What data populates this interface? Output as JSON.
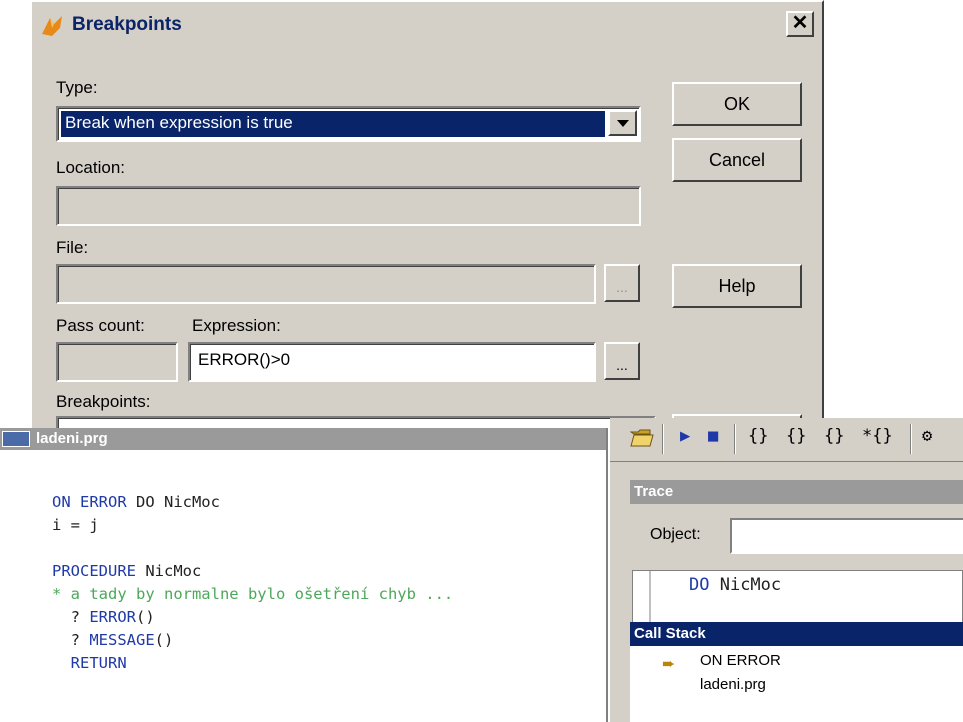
{
  "dialog": {
    "title": "Breakpoints",
    "close_label": "✕",
    "type_label": "Type:",
    "type_value": "Break when expression is true",
    "location_label": "Location:",
    "location_value": "",
    "file_label": "File:",
    "file_value": "",
    "pass_count_label": "Pass count:",
    "pass_count_value": "",
    "expression_label": "Expression:",
    "expression_value": "ERROR()>0",
    "breakpoints_label": "Breakpoints:",
    "browse_label": "...",
    "ok_label": "OK",
    "cancel_label": "Cancel",
    "help_label": "Help"
  },
  "editor": {
    "title": "ladeni.prg",
    "lines": [
      {
        "kw": "ON ERROR",
        "tx": " DO NicMoc"
      },
      {
        "kw": "",
        "tx": "i = j"
      },
      {
        "kw": "",
        "tx": ""
      },
      {
        "kw": "PROCEDURE",
        "tx": " NicMoc"
      },
      {
        "cm": "* a tady by normalne bylo ošetření chyb ..."
      },
      {
        "tx": "  ? ",
        "kw": "ERROR",
        "tx2": "()"
      },
      {
        "tx": "  ? ",
        "kw": "MESSAGE",
        "tx2": "()"
      },
      {
        "kw": "  RETURN"
      }
    ]
  },
  "debugger": {
    "toolbar": [
      "{}",
      "{}",
      "{}",
      "*{}"
    ],
    "trace_title": "Trace",
    "object_label": "Object:",
    "object_value": "",
    "trace_line_kw": "DO",
    "trace_line_tx": " NicMoc",
    "callstack_title": "Call Stack",
    "callstack_items": [
      "ON ERROR",
      "ladeni.prg"
    ]
  }
}
